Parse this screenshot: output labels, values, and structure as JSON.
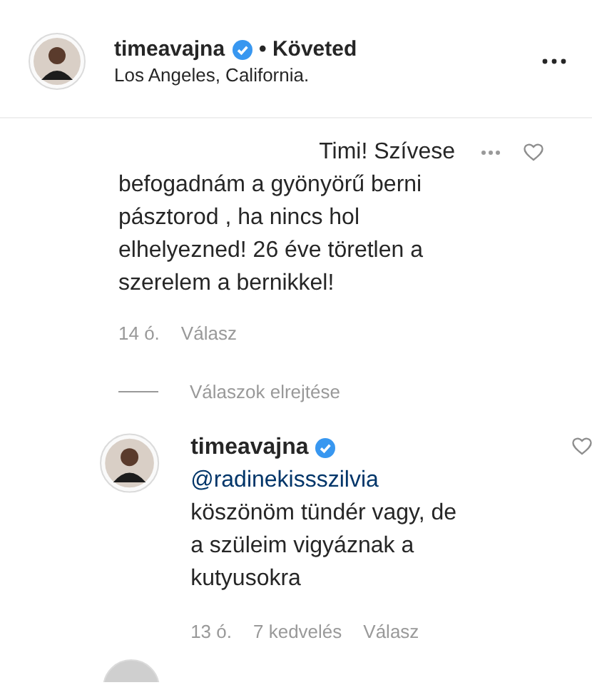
{
  "header": {
    "username": "timeavajna",
    "verified": true,
    "follow_status": "• Követed",
    "location": "Los Angeles, California."
  },
  "comment": {
    "first_line": "Timi! Szívese",
    "body": "befogadnám a gyönyörű berni pásztorod , ha nincs hol elhelyezned! 26 éve töretlen a szerelem a bernikkel!",
    "time": "14 ó.",
    "reply": "Válasz"
  },
  "replies_toggle": "Válaszok elrejtése",
  "reply": {
    "username": "timeavajna",
    "verified": true,
    "mention": "@radinekissszilvia",
    "text": "köszönöm tündér vagy, de a szüleim vigyáznak a kutyusokra",
    "time": "13 ó.",
    "likes": "7 kedvelés",
    "reply": "Válasz"
  }
}
